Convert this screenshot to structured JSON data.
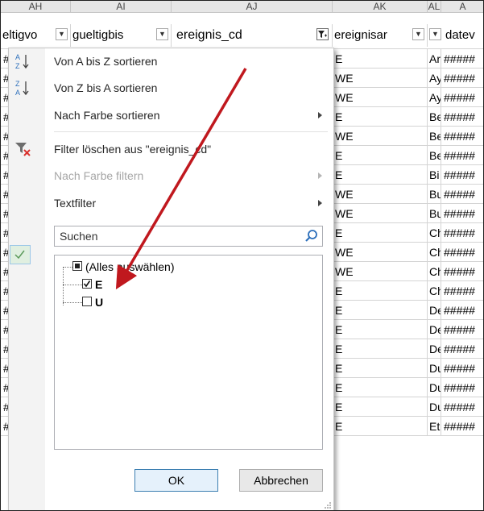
{
  "columns": [
    "AH",
    "AI",
    "AJ",
    "AK",
    "AL",
    "A"
  ],
  "fields": {
    "gueltigvon": "eltigvo",
    "gueltigbis": "gueltigbis",
    "ereignis_cd": "ereignis_cd",
    "ereignisart": "ereignisar",
    "datev": "datev"
  },
  "rows": [
    {
      "a": "##",
      "k": "E",
      "l": "Ar",
      "m": "#####"
    },
    {
      "a": "##",
      "k": "WE",
      "l": "Ay",
      "m": "#####"
    },
    {
      "a": "##",
      "k": "WE",
      "l": "Ay",
      "m": "#####"
    },
    {
      "a": "##",
      "k": "E",
      "l": "Be",
      "m": "#####"
    },
    {
      "a": "##",
      "k": "WE",
      "l": "Be",
      "m": "#####"
    },
    {
      "a": "##",
      "k": "E",
      "l": "Be",
      "m": "#####"
    },
    {
      "a": "##",
      "k": "E",
      "l": "Bi",
      "m": "#####"
    },
    {
      "a": "##",
      "k": "WE",
      "l": "Bu",
      "m": "#####"
    },
    {
      "a": "##",
      "k": "WE",
      "l": "Bu",
      "m": "#####"
    },
    {
      "a": "##",
      "k": "E",
      "l": "Ch",
      "m": "#####"
    },
    {
      "a": "##",
      "k": "WE",
      "l": "Ch",
      "m": "#####"
    },
    {
      "a": "##",
      "k": "WE",
      "l": "Ch",
      "m": "#####"
    },
    {
      "a": "##",
      "k": "E",
      "l": "Ch",
      "m": "#####"
    },
    {
      "a": "##",
      "k": "E",
      "l": "De",
      "m": "#####"
    },
    {
      "a": "##",
      "k": "E",
      "l": "De",
      "m": "#####"
    },
    {
      "a": "##",
      "k": "E",
      "l": "De",
      "m": "#####"
    },
    {
      "a": "##",
      "k": "E",
      "l": "Du",
      "m": "#####"
    },
    {
      "a": "##",
      "k": "E",
      "l": "Du",
      "m": "#####"
    },
    {
      "a": "##",
      "k": "E",
      "l": "Du",
      "m": "#####"
    },
    {
      "a": "##",
      "k": "E",
      "l": "Et",
      "m": "#####"
    }
  ],
  "menu": {
    "sort_az": "Von A bis Z sortieren",
    "sort_za": "Von Z bis A sortieren",
    "sort_color": "Nach Farbe sortieren",
    "clear_filter": "Filter löschen aus \"ereignis_cd\"",
    "filter_color": "Nach Farbe filtern",
    "text_filter": "Textfilter"
  },
  "search": {
    "placeholder": "Suchen"
  },
  "filter_list": {
    "select_all": "(Alles auswählen)",
    "items": [
      {
        "label": "E",
        "checked": true
      },
      {
        "label": "U",
        "checked": false
      }
    ]
  },
  "buttons": {
    "ok": "OK",
    "cancel": "Abbrechen"
  },
  "colors": {
    "highlight": "#f6f274",
    "arrow": "#c0181e"
  },
  "icons": [
    "sort-az-icon",
    "sort-za-icon",
    "clear-filter-icon",
    "search-icon",
    "filter-active-icon",
    "dropdown-arrow-icon",
    "check-icon",
    "resize-grip-icon"
  ]
}
